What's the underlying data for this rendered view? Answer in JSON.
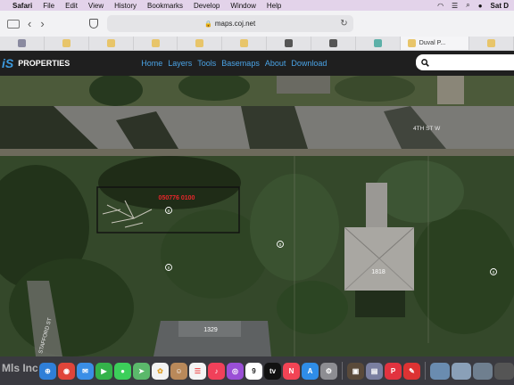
{
  "menubar": {
    "items": [
      "Safari",
      "File",
      "Edit",
      "View",
      "History",
      "Bookmarks",
      "Develop",
      "Window",
      "Help"
    ],
    "clock": "Sat D"
  },
  "browser": {
    "url": "maps.coj.net",
    "active_tab_title": "Duval P..."
  },
  "site": {
    "brand": "iS",
    "title": "PROPERTIES",
    "nav": [
      "Home",
      "Layers",
      "Tools",
      "Basemaps",
      "About",
      "Download"
    ]
  },
  "map": {
    "street_main": "4TH ST W",
    "street_side": "STAFFORD ST",
    "parcel_id": "050776 0100",
    "house_numbers": [
      "1818",
      "1329"
    ],
    "parcel_markers": [
      "0",
      "0",
      "0",
      "0"
    ],
    "colors": {
      "parcel_highlight": "#e8262b",
      "parcel_outline": "#111111"
    }
  },
  "dock": {
    "calendar_day": "9",
    "watermark": "Mls Inc"
  }
}
